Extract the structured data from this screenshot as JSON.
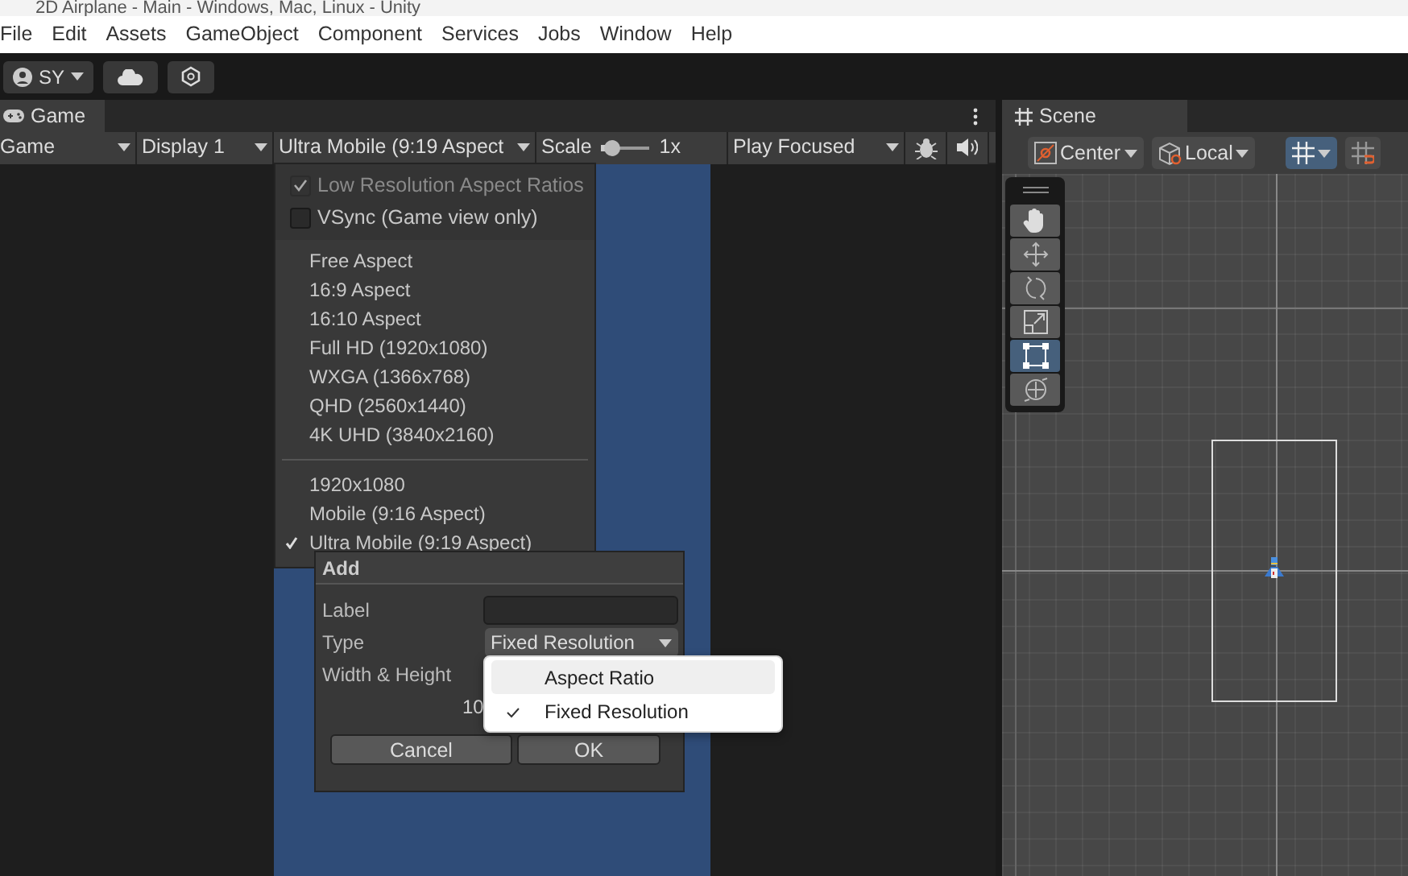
{
  "window": {
    "title": "2D Airplane - Main - Windows, Mac, Linux - Unity"
  },
  "menu_bar": [
    "File",
    "Edit",
    "Assets",
    "GameObject",
    "Component",
    "Services",
    "Jobs",
    "Window",
    "Help"
  ],
  "toolbar": {
    "account": "SY"
  },
  "game_panel": {
    "tab": "Game",
    "view": "Game",
    "display": "Display 1",
    "aspect": "Ultra Mobile (9:19 Aspect",
    "scale_label": "Scale",
    "scale": {
      "level": 0.08
    },
    "scale_value": "1x",
    "play_mode": "Play Focused",
    "stats_on": true,
    "aspect_menu": {
      "toggles": [
        {
          "label": "Low Resolution Aspect Ratios",
          "checked": true,
          "disabled": true
        },
        {
          "label": "VSync (Game view only)",
          "checked": false,
          "disabled": false
        }
      ],
      "groups": [
        [
          {
            "label": "Free Aspect",
            "selected": false
          },
          {
            "label": "16:9 Aspect",
            "selected": false
          },
          {
            "label": "16:10 Aspect",
            "selected": false
          },
          {
            "label": "Full HD (1920x1080)",
            "selected": false
          },
          {
            "label": "WXGA (1366x768)",
            "selected": false
          },
          {
            "label": "QHD (2560x1440)",
            "selected": false
          },
          {
            "label": "4K UHD (3840x2160)",
            "selected": false
          }
        ],
        [
          {
            "label": "1920x1080",
            "selected": false
          },
          {
            "label": "Mobile (9:16 Aspect)",
            "selected": false
          },
          {
            "label": "Ultra Mobile (9:19 Aspect)",
            "selected": true
          }
        ]
      ]
    },
    "add_dialog": {
      "title": "Add",
      "label_label": "Label",
      "type_label": "Type",
      "type_value": "Fixed Resolution",
      "size_label": "Width & Height",
      "size_value": "10",
      "buttons": [
        "Cancel",
        "OK"
      ],
      "type_options": [
        {
          "label": "Aspect Ratio",
          "selected": false,
          "highlighted": true
        },
        {
          "label": "Fixed Resolution",
          "selected": true,
          "highlighted": false
        }
      ]
    }
  },
  "scene_panel": {
    "tab": "Scene",
    "pivot": "Center",
    "space": "Local",
    "grid_snapping": {
      "selected": true
    },
    "tools": [
      {
        "kind": "hand",
        "selected": false
      },
      {
        "kind": "move",
        "selected": false
      },
      {
        "kind": "rotate",
        "selected": false
      },
      {
        "kind": "scale",
        "selected": false
      },
      {
        "kind": "rect",
        "selected": true
      },
      {
        "kind": "transform",
        "selected": false
      }
    ]
  }
}
